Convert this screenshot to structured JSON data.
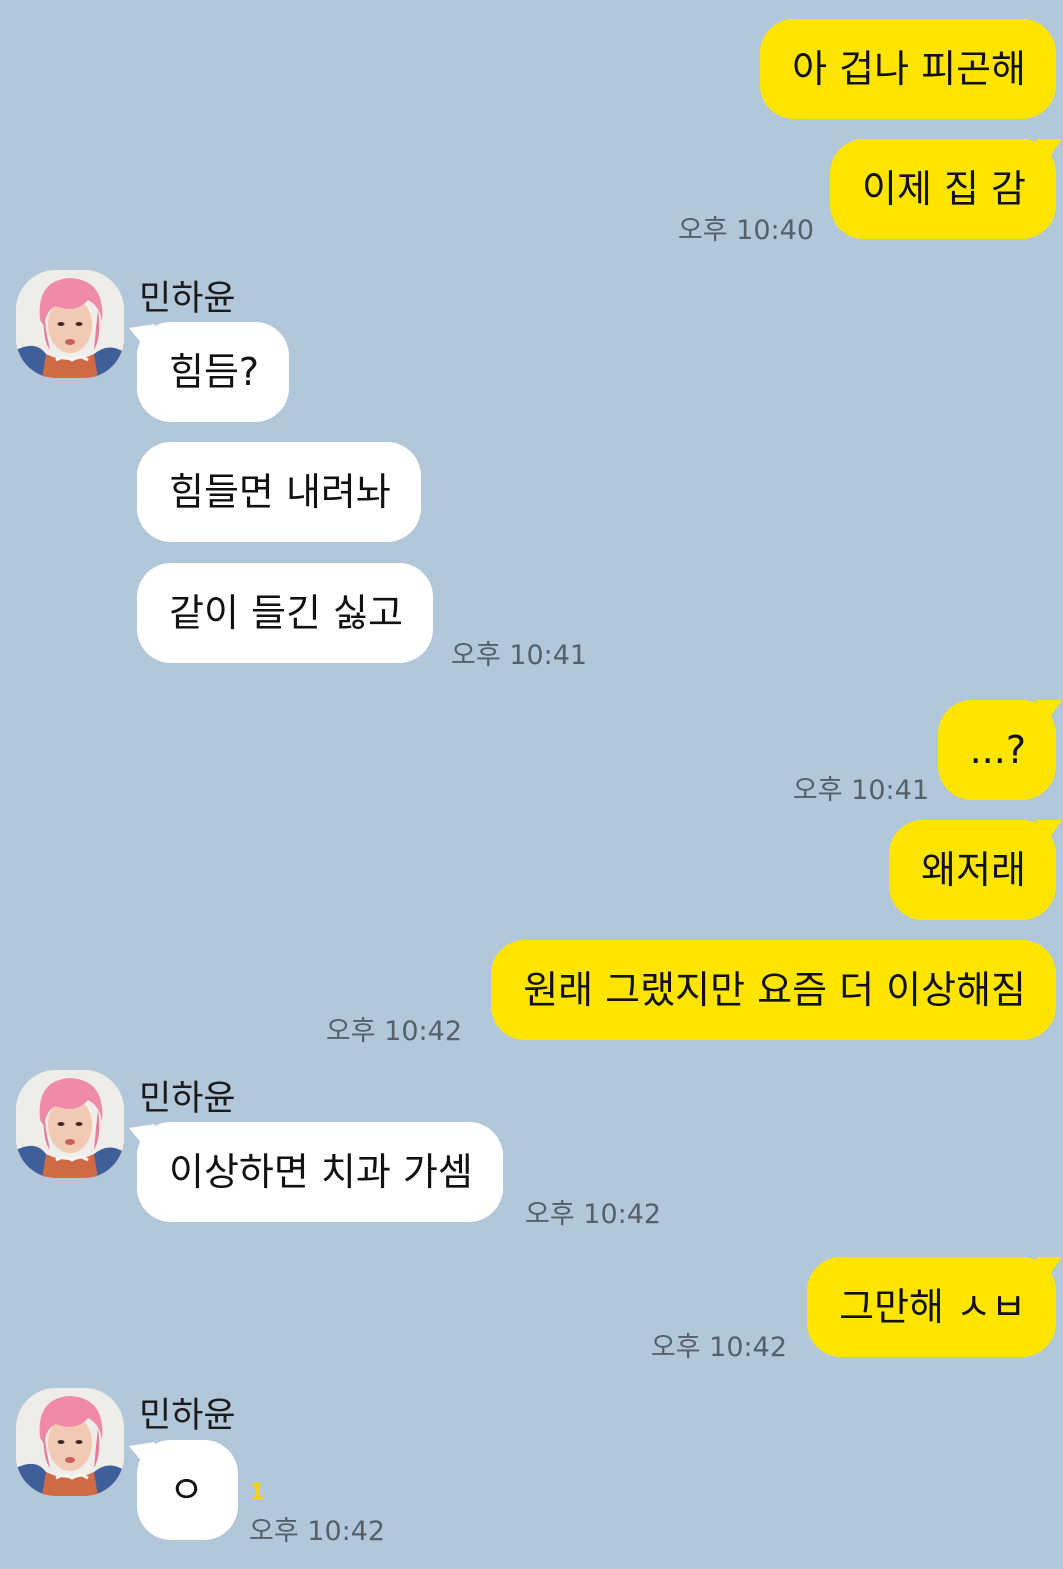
{
  "contact": {
    "name": "민하윤"
  },
  "messages": [
    {
      "from": "me",
      "text": "아 겁나 피곤해"
    },
    {
      "from": "me",
      "text": "이제 집 감",
      "time": "오후 10:40"
    },
    {
      "from": "them",
      "sender": "민하윤",
      "text": "힘듬?"
    },
    {
      "from": "them",
      "text": "힘들면 내려놔"
    },
    {
      "from": "them",
      "text": "같이 들긴 싫고",
      "time": "오후 10:41"
    },
    {
      "from": "me",
      "text": "...?",
      "time": "오후 10:41"
    },
    {
      "from": "me",
      "text": "왜저래"
    },
    {
      "from": "me",
      "text": "원래 그랬지만 요즘 더 이상해짐",
      "time": "오후 10:42"
    },
    {
      "from": "them",
      "sender": "민하윤",
      "text": "이상하면 치과 가셈",
      "time": "오후 10:42"
    },
    {
      "from": "me",
      "text": "그만해 ㅅㅂ",
      "time": "오후 10:42"
    },
    {
      "from": "them",
      "sender": "민하윤",
      "text": "ㅇ",
      "time": "오후 10:42",
      "unread": "1"
    }
  ],
  "colors": {
    "background": "#b2c7da",
    "my_bubble": "#fee500",
    "their_bubble": "#ffffff",
    "timestamp": "#55606b",
    "unread_count": "#f3d21e"
  },
  "icons": {
    "avatar": "pink-hair-profile-photo"
  }
}
